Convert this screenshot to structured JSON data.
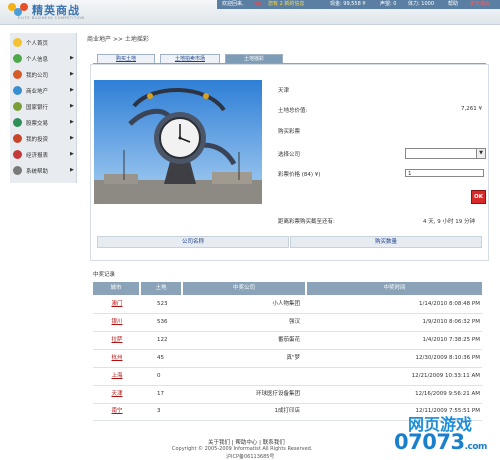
{
  "brand": {
    "title": "精英商战",
    "subtitle": "ELITE BUSINESS COMPETITION"
  },
  "userbar": {
    "welcome": "欢迎回来,",
    "username": "fanl",
    "messages": "您有 2 新的信息",
    "cash": "现金: 99,558 ¥",
    "prestige": "声望: 0",
    "stamina": "体力: 1000",
    "help": "帮助",
    "logout": "安全退出"
  },
  "sidebar": {
    "items": [
      {
        "label": "个人首页",
        "icon": "smiley-icon",
        "color": "#f2c230"
      },
      {
        "label": "个人信息",
        "icon": "person-icon",
        "color": "#4fa84a"
      },
      {
        "label": "我的公司",
        "icon": "company-icon",
        "color": "#d65a2a"
      },
      {
        "label": "商业地产",
        "icon": "globe-icon",
        "color": "#3a8fd0"
      },
      {
        "label": "国家银行",
        "icon": "bank-icon",
        "color": "#7a9e3a"
      },
      {
        "label": "股票交易",
        "icon": "stock-icon",
        "color": "#2f8f5a"
      },
      {
        "label": "我的投资",
        "icon": "invest-icon",
        "color": "#c8452a"
      },
      {
        "label": "经济报表",
        "icon": "report-icon",
        "color": "#c43a3a"
      },
      {
        "label": "系统帮助",
        "icon": "help-icon",
        "color": "#7a7a7a"
      }
    ]
  },
  "breadcrumb": "商业地产  >>  土地摇彩",
  "tabs": [
    {
      "label": "购买土地"
    },
    {
      "label": "土地拍卖市场"
    },
    {
      "label": "土地摇彩",
      "active": true
    }
  ],
  "lottery": {
    "city": "天津",
    "total_price_label": "土地总价值:",
    "total_price_value": "7,261 ¥",
    "buy_ticket": "购买彩票",
    "select_company_label": "选择公司",
    "ticket_price_label": "彩票价格 (84) ¥)",
    "ticket_qty": "1",
    "ok": "OK",
    "countdown_label": "距离彩票购买截至还有:",
    "countdown_value": "4 天,  9 小时 19 分钟",
    "col_company": "公司名称",
    "col_qty": "购买数量"
  },
  "records": {
    "title": "中奖记录",
    "headers": [
      "城市",
      "土地",
      "中奖公司",
      "中奖时间"
    ],
    "rows": [
      {
        "city": "澳门",
        "land": "523",
        "company": "小人物集团",
        "time": "1/14/2010 8:08:48 PM"
      },
      {
        "city": "银川",
        "land": "536",
        "company": "强汉",
        "time": "1/9/2010 8:06:32 PM"
      },
      {
        "city": "拉萨",
        "land": "122",
        "company": "番茄蛋花",
        "time": "1/4/2010 7:38:25 PM"
      },
      {
        "city": "杭州",
        "land": "45",
        "company": "真\"梦",
        "time": "12/30/2009 8:10:36 PM"
      },
      {
        "city": "上海",
        "land": "0",
        "company": "",
        "time": "12/21/2009 10:33:11 AM"
      },
      {
        "city": "天津",
        "land": "17",
        "company": "环球医疗设备集团",
        "time": "12/16/2009 9:56:21 AM"
      },
      {
        "city": "南宁",
        "land": "3",
        "company": "1成打印店",
        "time": "12/11/2009 7:55:51 PM"
      }
    ]
  },
  "footer": {
    "links": "关于我们 | 帮助中心 | 联系我们",
    "copyright": "Copyright © 2005-2009 Informatist All Rights Reserved.",
    "icp": "沪ICP备06113685号"
  },
  "watermark": {
    "text": "网页游戏",
    "number": "07073",
    "suffix": ".com"
  }
}
